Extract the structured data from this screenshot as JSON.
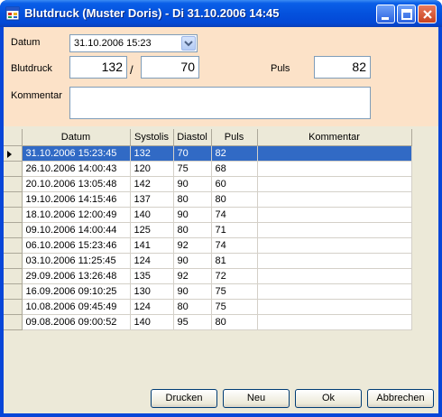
{
  "window": {
    "title": "Blutdruck (Muster Doris) - Di 31.10.2006 14:45"
  },
  "form": {
    "datum_label": "Datum",
    "datum_value": "31.10.2006 15:23",
    "blutdruck_label": "Blutdruck",
    "systolic_value": "132",
    "separator": "/",
    "diastolic_value": "70",
    "puls_label": "Puls",
    "puls_value": "82",
    "kommentar_label": "Kommentar",
    "kommentar_value": ""
  },
  "table": {
    "columns": [
      "Datum",
      "Systolis",
      "Diastol",
      "Puls",
      "Kommentar"
    ],
    "selected_row": 0,
    "rows": [
      [
        "31.10.2006 15:23:45",
        "132",
        "70",
        "82",
        ""
      ],
      [
        "26.10.2006 14:00:43",
        "120",
        "75",
        "68",
        ""
      ],
      [
        "20.10.2006 13:05:48",
        "142",
        "90",
        "60",
        ""
      ],
      [
        "19.10.2006 14:15:46",
        "137",
        "80",
        "80",
        ""
      ],
      [
        "18.10.2006 12:00:49",
        "140",
        "90",
        "74",
        ""
      ],
      [
        "09.10.2006 14:00:44",
        "125",
        "80",
        "71",
        ""
      ],
      [
        "06.10.2006 15:23:46",
        "141",
        "92",
        "74",
        ""
      ],
      [
        "03.10.2006 11:25:45",
        "124",
        "90",
        "81",
        ""
      ],
      [
        "29.09.2006 13:26:48",
        "135",
        "92",
        "72",
        ""
      ],
      [
        "16.09.2006 09:10:25",
        "130",
        "90",
        "75",
        ""
      ],
      [
        "10.08.2006 09:45:49",
        "124",
        "80",
        "75",
        ""
      ],
      [
        "09.08.2006 09:00:52",
        "140",
        "95",
        "80",
        ""
      ]
    ]
  },
  "buttons": {
    "print": "Drucken",
    "new": "Neu",
    "ok": "Ok",
    "cancel": "Abbrechen"
  },
  "colors": {
    "header_background": "#fce2c8",
    "selection": "#316ac5",
    "titlebar": "#0451dd"
  },
  "icons": {
    "app": "app-window-icon",
    "minimize": "minimize-icon",
    "maximize": "maximize-icon",
    "close": "close-icon",
    "dropdown": "chevron-down-icon",
    "row_pointer": "row-pointer-icon"
  }
}
